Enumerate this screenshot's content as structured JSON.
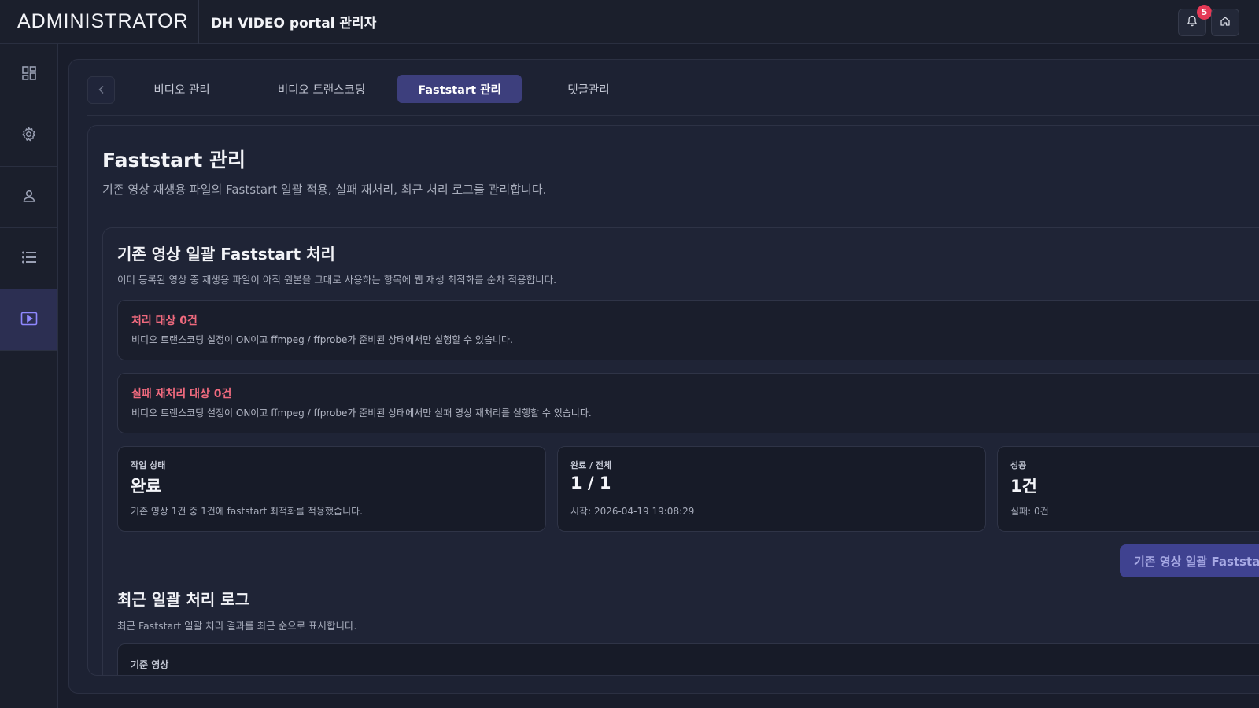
{
  "header": {
    "brand": "ADMINISTRATOR",
    "portal_title": "DH VIDEO portal 관리자",
    "notification_count": "5"
  },
  "sidebar": {
    "items": [
      {
        "icon": "dashboard-icon"
      },
      {
        "icon": "gear-icon"
      },
      {
        "icon": "user-icon"
      },
      {
        "icon": "list-icon"
      },
      {
        "icon": "video-icon",
        "active": true
      }
    ]
  },
  "tabs": [
    {
      "label": "비디오 관리"
    },
    {
      "label": "비디오 트랜스코딩"
    },
    {
      "label": "Faststart 관리",
      "active": true
    },
    {
      "label": "댓글관리"
    }
  ],
  "page": {
    "title": "Faststart 관리",
    "description": "기존 영상 재생용 파일의 Faststart 일괄 적용, 실패 재처리, 최근 처리 로그를 관리합니다."
  },
  "bulk_section": {
    "title": "기존 영상 일괄 Faststart 처리",
    "description": "이미 등록된 영상 중 재생용 파일이 아직 원본을 그대로 사용하는 항목에 웹 재생 최적화를 순차 적용합니다.",
    "alerts": [
      {
        "title": "처리 대상 0건",
        "description": "비디오 트랜스코딩 설정이 ON이고 ffmpeg / ffprobe가 준비된 상태에서만 실행할 수 있습니다."
      },
      {
        "title": "실패 재처리 대상 0건",
        "description": "비디오 트랜스코딩 설정이 ON이고 ffmpeg / ffprobe가 준비된 상태에서만 실패 영상 재처리를 실행할 수 있습니다."
      }
    ],
    "stats": [
      {
        "label": "작업 상태",
        "value": "완료",
        "sub": "기존 영상 1건 중 1건에 faststart 최적화를 적용했습니다."
      },
      {
        "label": "완료 / 전체",
        "value": "1 / 1",
        "sub": "시작: 2026-04-19 19:08:29"
      },
      {
        "label": "성공",
        "value": "1건",
        "sub": "실패: 0건"
      }
    ],
    "run_button": "기존 영상 일괄 Faststart"
  },
  "log_section": {
    "title": "최근 일괄 처리 로그",
    "description": "최근 Faststart 일괄 처리 결과를 최근 순으로 표시합니다.",
    "card_label": "기준 영상"
  }
}
